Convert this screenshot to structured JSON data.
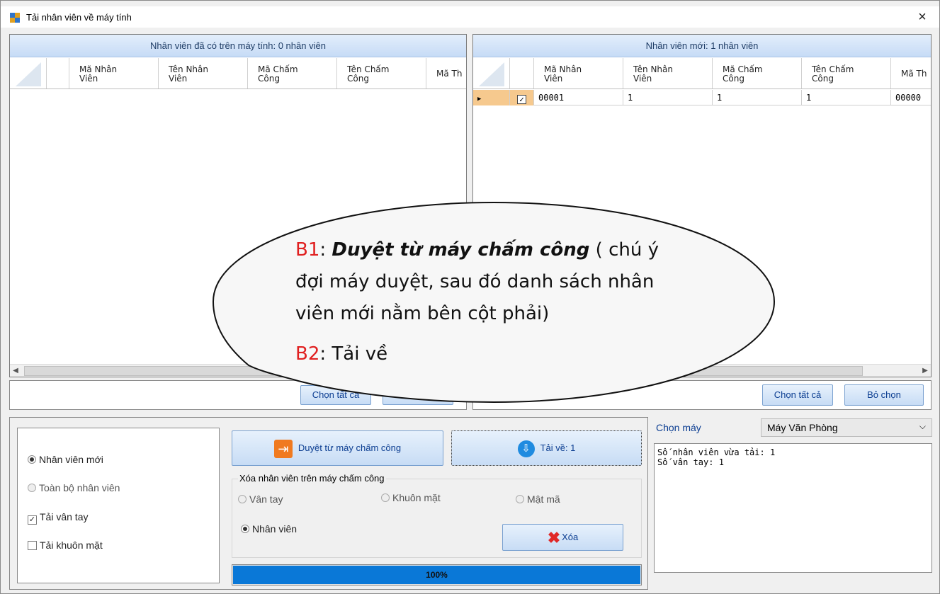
{
  "window": {
    "title": "Tải nhân viên về máy tính",
    "close_glyph": "×"
  },
  "left_grid": {
    "title": "Nhân viên đã có trên máy tính: 0 nhân viên",
    "columns": [
      "Mã Nhân\nViên",
      "Tên Nhân\nViên",
      "Mã Chấm\nCông",
      "Tên Chấm\nCông",
      "Mã Th"
    ],
    "select_all": "Chọn tất cả"
  },
  "right_grid": {
    "title": "Nhân viên mới: 1 nhân viên",
    "columns": [
      "Mã Nhân\nViên",
      "Tên Nhân\nViên",
      "Mã Chấm\nCông",
      "Tên Chấm\nCông",
      "Mã Th"
    ],
    "rows": [
      {
        "checked": true,
        "cells": [
          "00001",
          "1",
          "1",
          "1",
          "00000"
        ]
      }
    ],
    "select_all": "Chọn tất cả",
    "deselect": "Bỏ chọn"
  },
  "options": {
    "new_employees": "Nhân viên mới",
    "all_employees": "Toàn bộ nhân viên",
    "download_fingerprint": "Tải vân tay",
    "download_face": "Tải khuôn mặt",
    "selected": "new_employees",
    "fingerprint_checked": true,
    "face_checked": false
  },
  "actions": {
    "browse_label": "Duyệt từ máy chấm công",
    "download_label": "Tải về: 1",
    "delete_group_label": "Xóa nhân viên trên máy chấm công",
    "del_fingerprint": "Vân tay",
    "del_face": "Khuôn mặt",
    "del_password": "Mật mã",
    "del_employee": "Nhân viên",
    "delete_label": "Xóa",
    "progress_text": "100%",
    "progress": 1.0
  },
  "machine": {
    "label": "Chọn máy",
    "selected": "Máy Văn Phòng",
    "log": [
      "Số nhân viên vừa tải: 1",
      "Số vân tay: 1"
    ]
  },
  "callout": {
    "b1_label": "B1",
    "b1_sep": ": ",
    "b1_bold": "Duyệt từ máy chấm công",
    "b1_rest": " ( chú ý đợi máy duyệt, sau đó danh sách nhân viên mới nằm bên cột phải)",
    "b2_label": "B2",
    "b2_text": ": Tải về"
  },
  "colors": {
    "accent": "#0a78d7",
    "grid_header": "#c6dbf6",
    "callout_red": "#e02020"
  }
}
